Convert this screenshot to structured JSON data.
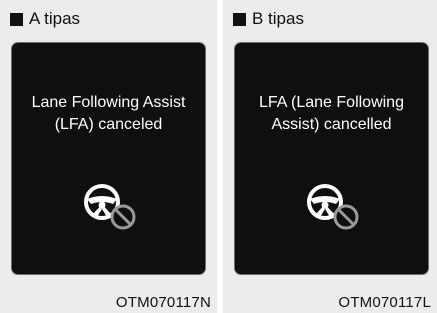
{
  "panels": [
    {
      "heading": "A tipas",
      "message_line1": "Lane Following Assist",
      "message_line2": "(LFA) canceled",
      "icon": "steering-wheel-cancel-icon",
      "code": "OTM070117N"
    },
    {
      "heading": "B tipas",
      "message_line1": "LFA (Lane Following",
      "message_line2": "Assist) cancelled",
      "icon": "steering-wheel-cancel-icon",
      "code": "OTM070117L"
    }
  ],
  "colors": {
    "panel_bg": "#ececec",
    "screen_bg": "#0f0f0f",
    "icon_white": "#ffffff",
    "icon_gray": "#9a9a9a"
  }
}
